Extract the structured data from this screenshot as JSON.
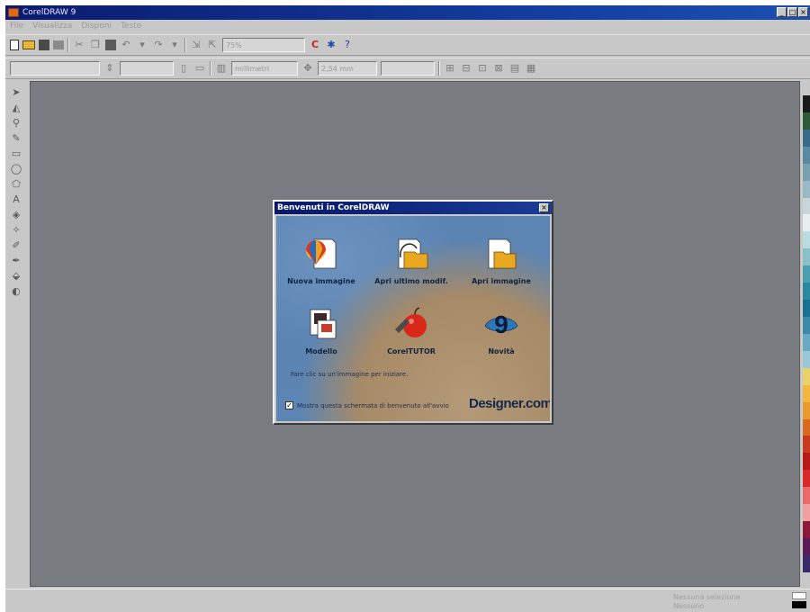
{
  "window": {
    "title": "CorelDRAW 9",
    "controls": [
      "_",
      "□",
      "×"
    ]
  },
  "menu": [
    "File",
    "Visualizza",
    "Disponi",
    "Testo"
  ],
  "toolbar1": {
    "zoom_value": "75%"
  },
  "toolbar2": {
    "units_value": "millimetri",
    "nudge_value": "2,54 mm"
  },
  "dialog": {
    "title": "Benvenuti in CorelDRAW",
    "close": "×",
    "options": [
      {
        "label": "Nuova immagine",
        "icon": "new-graphic-icon"
      },
      {
        "label": "Apri ultimo modif.",
        "icon": "open-last-edited-icon"
      },
      {
        "label": "Apri immagine",
        "icon": "open-graphic-icon"
      },
      {
        "label": "Modello",
        "icon": "template-icon"
      },
      {
        "label": "CorelTUTOR",
        "icon": "tutor-icon"
      },
      {
        "label": "Novità",
        "icon": "whats-new-icon"
      }
    ],
    "hint": "Fare clic su un'immagine per iniziare.",
    "startup_checkbox": {
      "checked": true,
      "mark": "✓",
      "label": "Mostra questa schermata di benvenuto all'avvio"
    },
    "brand": "Designer.com"
  },
  "status": {
    "line1": "Nessuna selezione",
    "line2": "Nessuno"
  },
  "palette": [
    "#1a1a1a",
    "#2f5a3a",
    "#3a6a8a",
    "#5a8aa0",
    "#7aa0b0",
    "#9ab8c6",
    "#c8d6da",
    "#e8eeee",
    "#b8dce0",
    "#8ac0c8",
    "#4aa0b0",
    "#2a88a0",
    "#1a7090",
    "#3a8aa8",
    "#6aaac0",
    "#9ac8d6",
    "#e8d06a",
    "#f0b840",
    "#e89a30",
    "#d86a20",
    "#c83a20",
    "#b81a1a",
    "#d82a2a",
    "#e86a6a",
    "#f0a0a0",
    "#8a1a3a",
    "#5a1a5a",
    "#3a2a6a"
  ]
}
